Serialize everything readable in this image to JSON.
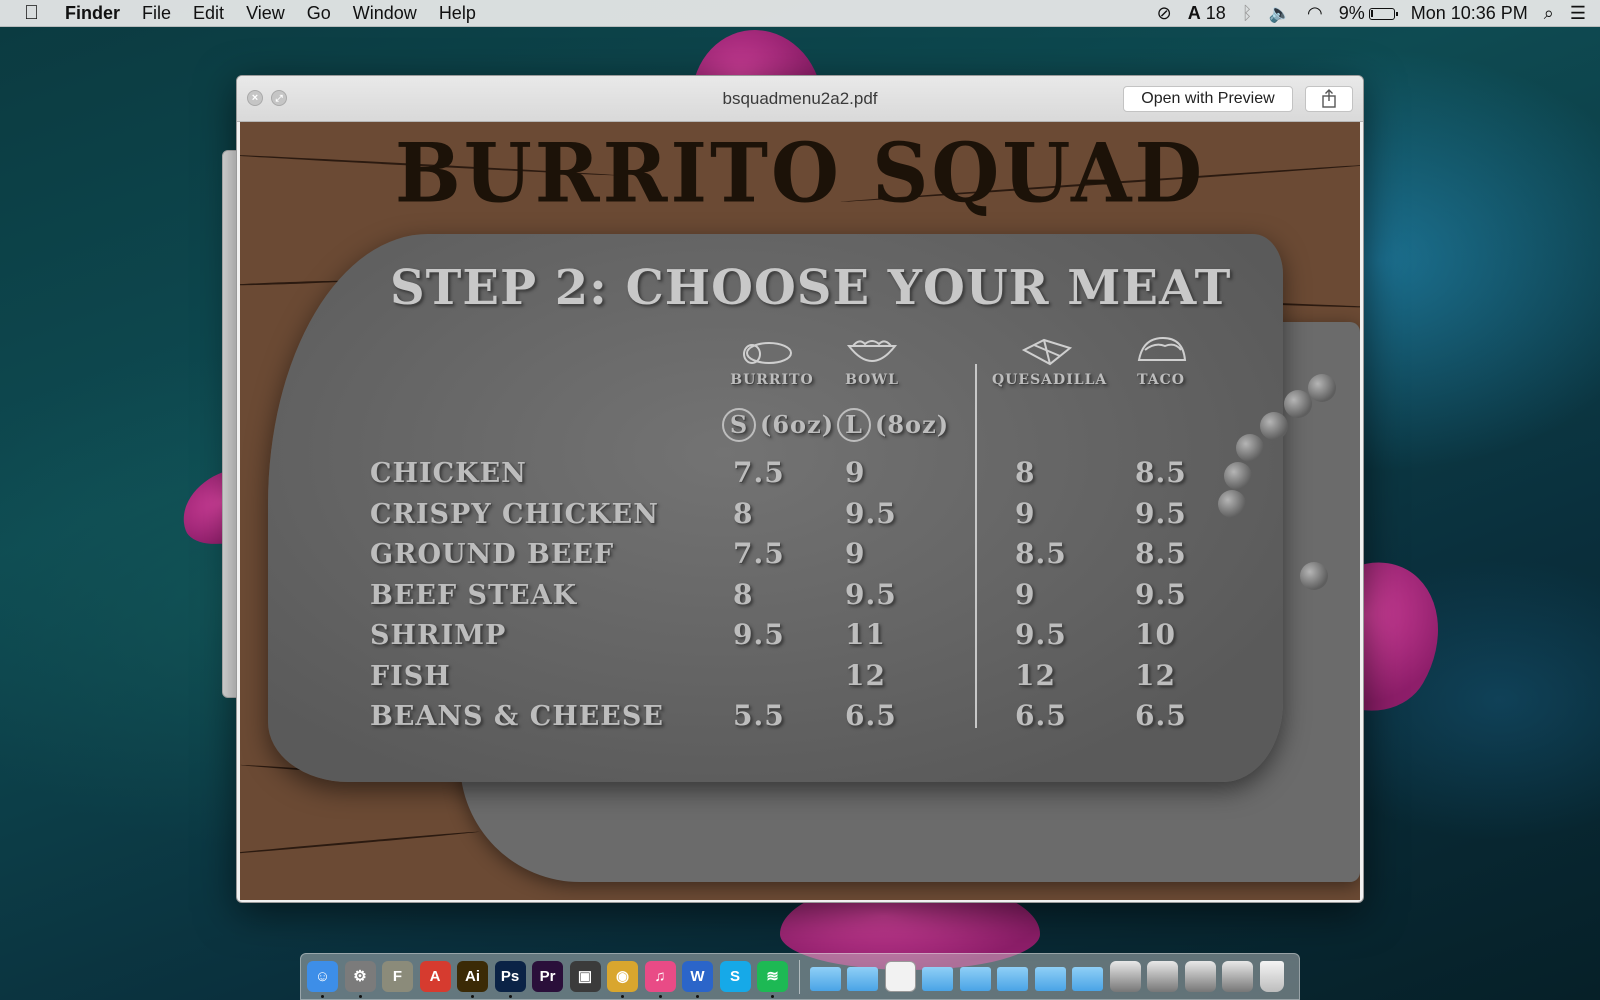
{
  "menubar": {
    "apple": "",
    "app": "Finder",
    "items": [
      "File",
      "Edit",
      "View",
      "Go",
      "Window",
      "Help"
    ],
    "adobe_count": "18",
    "battery_percent": "9%",
    "battery_level": 0.09,
    "clock": "Mon 10:36 PM"
  },
  "window": {
    "title": "bsquadmenu2a2.pdf",
    "open_with": "Open with Preview",
    "close_glyph": "×",
    "fullscreen_glyph": "⤢",
    "share_glyph": "⇪"
  },
  "menu": {
    "brand": "BURRITO SQUAD",
    "step_title": "STEP 2: CHOOSE YOUR MEAT",
    "columns": [
      {
        "label": "BURRITO",
        "icon": "burrito-icon"
      },
      {
        "label": "BOWL",
        "icon": "bowl-icon"
      },
      {
        "label": "QUESADILLA",
        "icon": "quesadilla-icon"
      },
      {
        "label": "TACO",
        "icon": "taco-icon"
      }
    ],
    "sizes": {
      "small_letter": "S",
      "small_text": "(6oz)",
      "large_letter": "L",
      "large_text": "(8oz)"
    },
    "rows": [
      {
        "meat": "CHICKEN",
        "prices": [
          "7.5",
          "9",
          "8",
          "8.5"
        ]
      },
      {
        "meat": "CRISPY CHICKEN",
        "prices": [
          "8",
          "9.5",
          "9",
          "9.5"
        ]
      },
      {
        "meat": "GROUND BEEF",
        "prices": [
          "7.5",
          "9",
          "8.5",
          "8.5"
        ]
      },
      {
        "meat": "BEEF STEAK",
        "prices": [
          "8",
          "9.5",
          "9",
          "9.5"
        ]
      },
      {
        "meat": "SHRIMP",
        "prices": [
          "9.5",
          "11",
          "9.5",
          "10"
        ]
      },
      {
        "meat": "FISH",
        "prices": [
          "",
          "12",
          "12",
          "12"
        ]
      },
      {
        "meat": "BEANS & CHEESE",
        "prices": [
          "5.5",
          "6.5",
          "6.5",
          "6.5"
        ]
      }
    ]
  },
  "dock": {
    "apps": [
      {
        "name": "finder",
        "glyph": "☺",
        "color": "#3d8ee8",
        "running": true
      },
      {
        "name": "system-preferences",
        "glyph": "⚙",
        "color": "#7b7b7b",
        "running": true
      },
      {
        "name": "fontlab",
        "glyph": "F",
        "color": "#8b8b7a",
        "running": false
      },
      {
        "name": "acrobat",
        "glyph": "A",
        "color": "#d63b2f",
        "running": false
      },
      {
        "name": "illustrator",
        "glyph": "Ai",
        "color": "#3b2a06",
        "running": true
      },
      {
        "name": "photoshop",
        "glyph": "Ps",
        "color": "#0b2346",
        "running": true
      },
      {
        "name": "premiere",
        "glyph": "Pr",
        "color": "#2a0f3a",
        "running": false
      },
      {
        "name": "window-manager",
        "glyph": "▣",
        "color": "#3b3b3b",
        "running": false
      },
      {
        "name": "chrome",
        "glyph": "◉",
        "color": "#d9a62e",
        "running": true
      },
      {
        "name": "itunes",
        "glyph": "♫",
        "color": "#e94b86",
        "running": true
      },
      {
        "name": "word",
        "glyph": "W",
        "color": "#2b65c9",
        "running": true
      },
      {
        "name": "skype",
        "glyph": "S",
        "color": "#16a9e8",
        "running": false
      },
      {
        "name": "spotify",
        "glyph": "≋",
        "color": "#1db954",
        "running": true
      }
    ],
    "stacks": [
      "folder",
      "folder",
      "doc",
      "folder",
      "folder",
      "apps-folder",
      "downloads-folder",
      "folder",
      "screenshot",
      "screenshot",
      "screenshot",
      "screenshot",
      "trash"
    ]
  }
}
